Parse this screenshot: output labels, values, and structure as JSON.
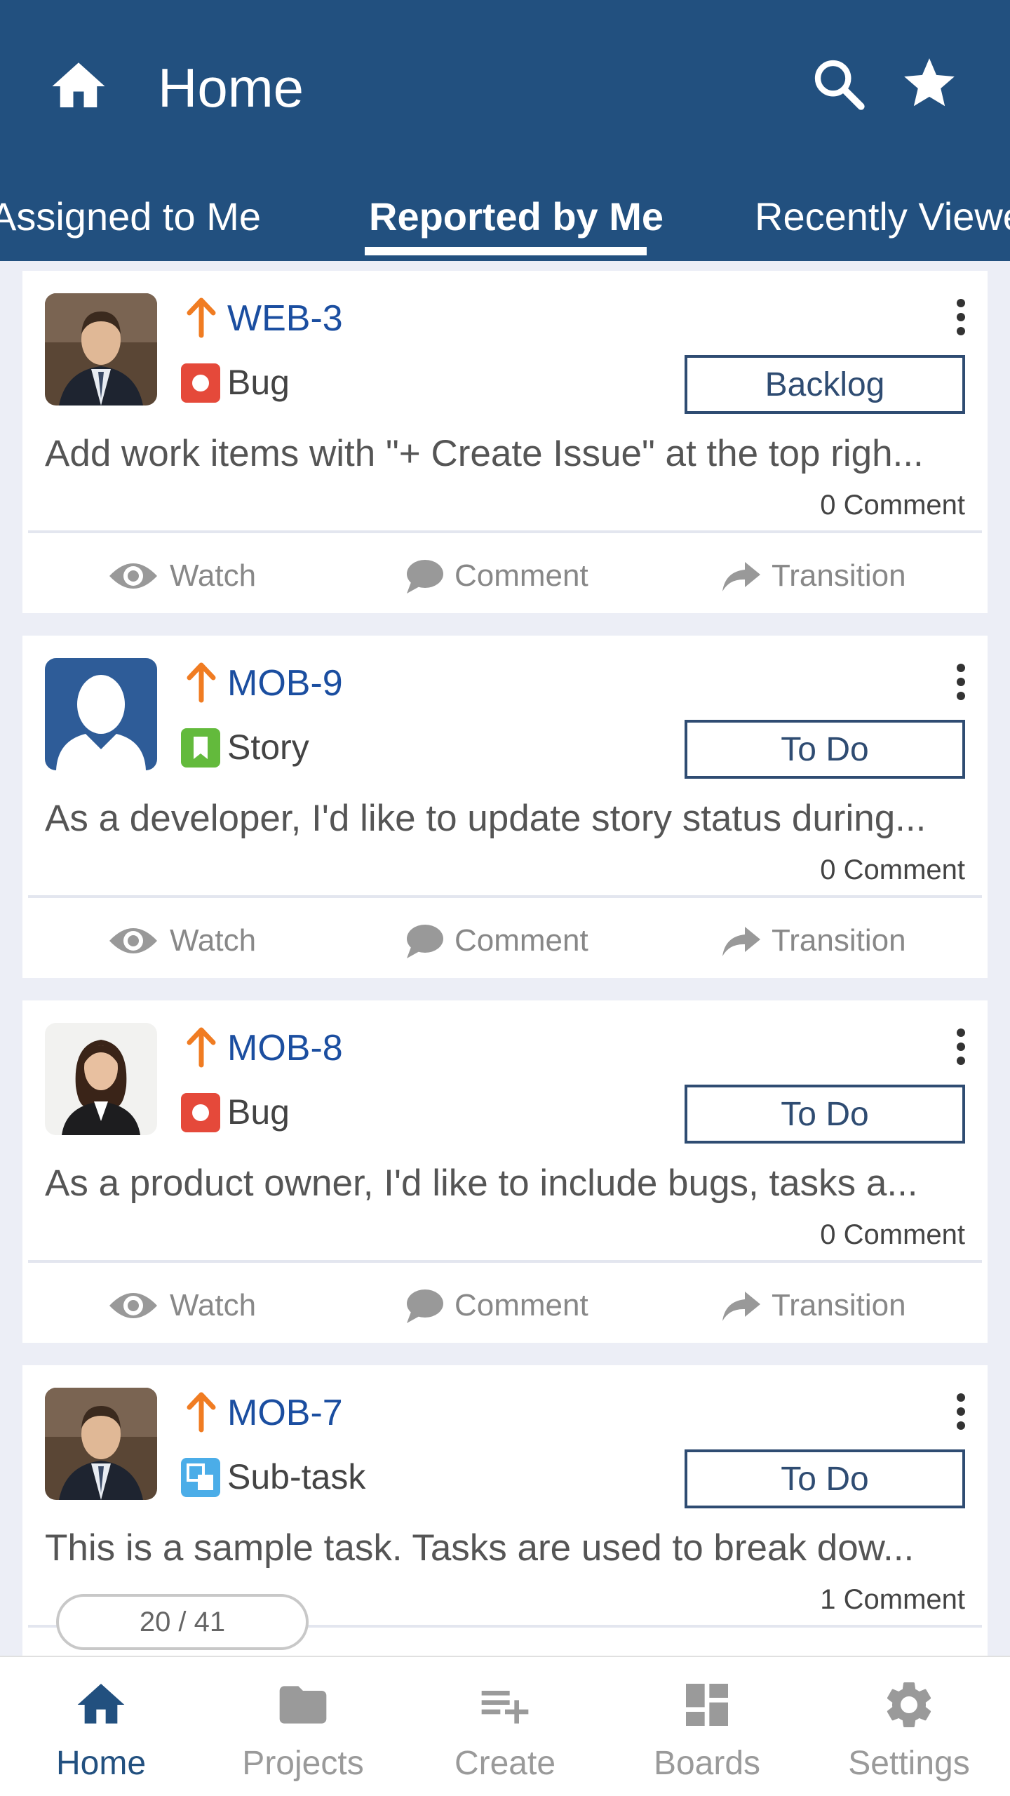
{
  "appbar": {
    "title": "Home",
    "colors": {
      "primary": "#22507f"
    },
    "icons": [
      "home-icon",
      "search-icon",
      "star-icon"
    ]
  },
  "tabs": [
    {
      "label": "Assigned to Me"
    },
    {
      "label": "Reported by Me",
      "active": true
    },
    {
      "label": "Recently Viewed"
    }
  ],
  "cards": [
    {
      "key": "WEB-3",
      "type": "Bug",
      "status": "Backlog",
      "summary": "Add work items with \"+ Create Issue\" at the top righ...",
      "comments": "0 Comment",
      "avatar": "man-avatar"
    },
    {
      "key": "MOB-9",
      "type": "Story",
      "status": "To Do",
      "summary": "As a developer, I'd like to update story status during...",
      "comments": "0 Comment",
      "avatar": "default-user-avatar"
    },
    {
      "key": "MOB-8",
      "type": "Bug",
      "status": "To Do",
      "summary": "As a product owner, I'd like to include bugs, tasks a...",
      "comments": "0 Comment",
      "avatar": "woman-avatar"
    },
    {
      "key": "MOB-7",
      "type": "Sub-task",
      "status": "To Do",
      "summary": "This is a sample task. Tasks are used to break dow...",
      "comments": "1 Comment",
      "avatar": "man-avatar"
    }
  ],
  "actions": {
    "watch": "Watch",
    "comment": "Comment",
    "transition": "Transition"
  },
  "pager": "20 / 41",
  "bottomnav": [
    {
      "label": "Home",
      "active": true
    },
    {
      "label": "Projects"
    },
    {
      "label": "Create"
    },
    {
      "label": "Boards"
    },
    {
      "label": "Settings"
    }
  ]
}
